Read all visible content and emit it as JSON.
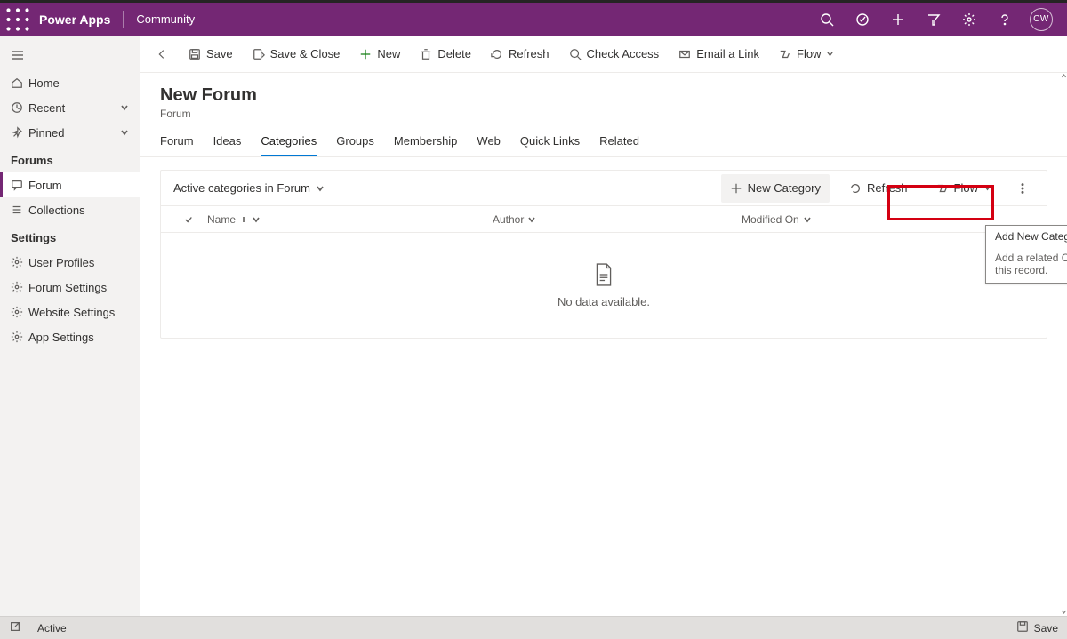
{
  "brand": "Power Apps",
  "environment": "Community",
  "avatar": "CW",
  "nav": {
    "home": "Home",
    "recent": "Recent",
    "pinned": "Pinned"
  },
  "sections": [
    {
      "header": "Forums",
      "items": [
        {
          "label": "Forum",
          "icon": "forum",
          "selected": true
        },
        {
          "label": "Collections",
          "icon": "collections",
          "selected": false
        }
      ]
    },
    {
      "header": "Settings",
      "items": [
        {
          "label": "User Profiles",
          "icon": "gear"
        },
        {
          "label": "Forum Settings",
          "icon": "gear"
        },
        {
          "label": "Website Settings",
          "icon": "gear"
        },
        {
          "label": "App Settings",
          "icon": "gear"
        }
      ]
    }
  ],
  "cmd": {
    "save": "Save",
    "saveClose": "Save & Close",
    "new": "New",
    "delete": "Delete",
    "refresh": "Refresh",
    "checkAccess": "Check Access",
    "emailLink": "Email a Link",
    "flow": "Flow"
  },
  "record": {
    "title": "New Forum",
    "entity": "Forum"
  },
  "tabs": [
    "Forum",
    "Ideas",
    "Categories",
    "Groups",
    "Membership",
    "Web",
    "Quick Links",
    "Related"
  ],
  "activeTab": "Categories",
  "subgrid": {
    "view": "Active categories in Forum",
    "buttons": {
      "newCategory": "New Category",
      "refresh": "Refresh",
      "flow": "Flow"
    },
    "columns": {
      "name": "Name",
      "author": "Author",
      "modifiedOn": "Modified On"
    },
    "emptyText": "No data available."
  },
  "tooltip": {
    "title": "Add New Category",
    "desc": "Add a related Category to this record."
  },
  "statusBar": {
    "status": "Active",
    "save": "Save"
  }
}
